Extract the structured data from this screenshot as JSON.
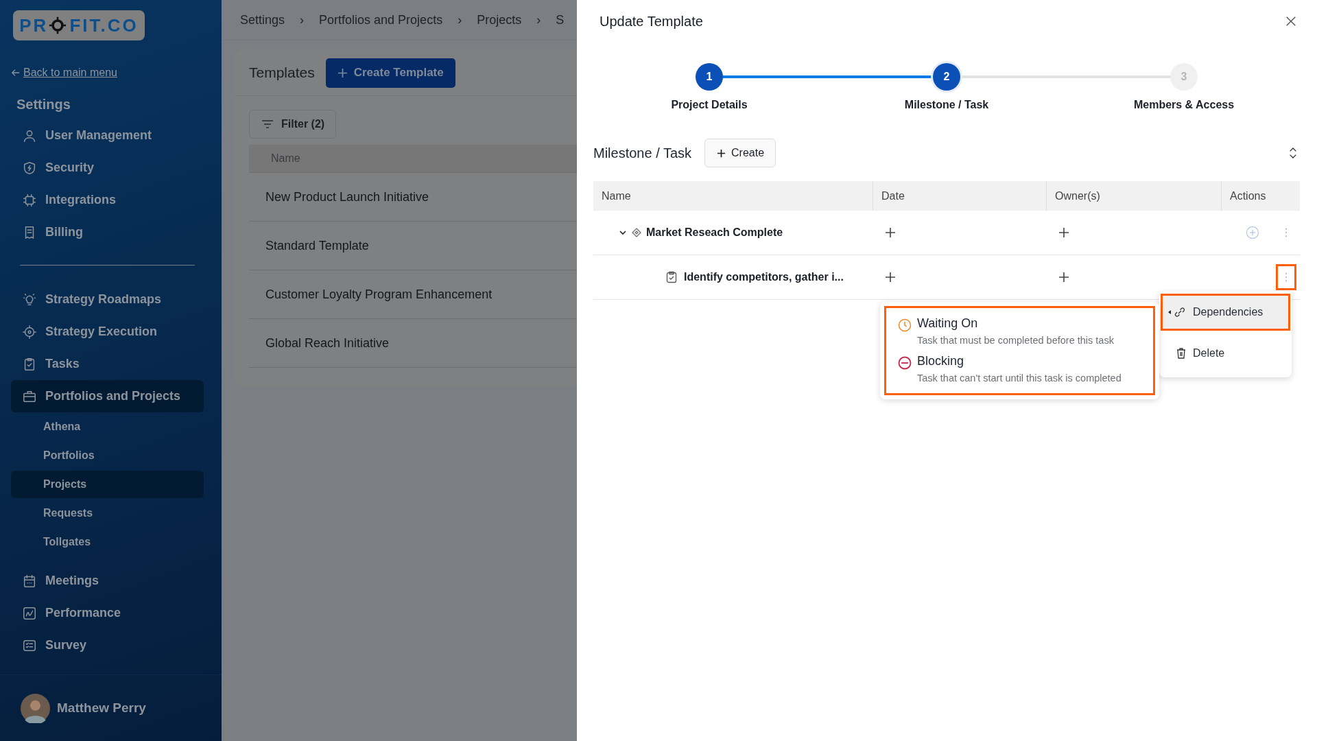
{
  "sidebar": {
    "logo": {
      "before": "PR",
      "after": "FIT.CO"
    },
    "back_link": "Back to main menu",
    "section_title": "Settings",
    "groups": [
      [
        {
          "label": "User Management",
          "selected": false
        },
        {
          "label": "Security",
          "selected": false
        },
        {
          "label": "Integrations",
          "selected": false
        },
        {
          "label": "Billing",
          "selected": false
        }
      ],
      [
        {
          "label": "Strategy Roadmaps",
          "selected": false
        },
        {
          "label": "Strategy Execution",
          "selected": false
        },
        {
          "label": "Tasks",
          "selected": false
        },
        {
          "label": "Portfolios and Projects",
          "selected": true,
          "children": [
            {
              "label": "Athena",
              "selected": false
            },
            {
              "label": "Portfolios",
              "selected": false
            },
            {
              "label": "Projects",
              "selected": true
            },
            {
              "label": "Requests",
              "selected": false
            },
            {
              "label": "Tollgates",
              "selected": false
            }
          ]
        }
      ],
      [
        {
          "label": "Meetings",
          "selected": false
        },
        {
          "label": "Performance",
          "selected": false
        },
        {
          "label": "Survey",
          "selected": false
        }
      ]
    ],
    "user": {
      "name": "Matthew Perry"
    }
  },
  "main": {
    "breadcrumb": [
      "Settings",
      "Portfolios and Projects",
      "Projects",
      "S"
    ],
    "breadcrumb_separator": "›",
    "title": "Templates",
    "create_button": "Create Template",
    "filter_button": "Filter (2)",
    "table": {
      "columns": [
        "Name"
      ],
      "rows": [
        "New Product Launch Initiative",
        "Standard Template",
        "Customer Loyalty Program Enhancement",
        "Global Reach Initiative"
      ]
    }
  },
  "drawer": {
    "title": "Update Template",
    "steps": [
      {
        "number": "1",
        "label": "Project Details",
        "selected": false
      },
      {
        "number": "2",
        "label": "Milestone / Task",
        "selected": true
      },
      {
        "number": "3",
        "label": "Members & Access",
        "selected": false
      }
    ],
    "section_title": "Milestone / Task",
    "create_button": "Create",
    "columns": [
      "Name",
      "Date",
      "Owner(s)",
      "Actions"
    ],
    "rows": [
      {
        "kind": "milestone",
        "name": "Market Reseach Complete",
        "expanded": true,
        "highlighted": false,
        "children": [
          {
            "kind": "task",
            "name": "Identify competitors, gather i...",
            "highlighted": true
          }
        ]
      }
    ],
    "menu": {
      "items": [
        {
          "kind": "dependencies",
          "label": "Dependencies",
          "selected": true,
          "highlighted": true
        },
        {
          "kind": "delete",
          "label": "Delete",
          "selected": false,
          "highlighted": false
        }
      ]
    },
    "submenu": {
      "highlighted": true,
      "items": [
        {
          "kind": "waiting",
          "title": "Waiting On",
          "description": "Task that must be completed before this task"
        },
        {
          "kind": "blocking",
          "title": "Blocking",
          "description": "Task that can't start until this task is completed"
        }
      ]
    }
  }
}
